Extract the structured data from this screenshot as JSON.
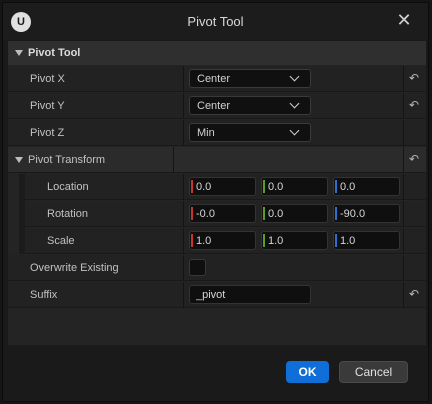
{
  "window": {
    "title": "Pivot Tool",
    "logo_text": "U"
  },
  "categories": {
    "pivot_tool": "Pivot Tool",
    "pivot_transform": "Pivot Transform"
  },
  "properties": {
    "pivot_x": {
      "label": "Pivot X",
      "value": "Center"
    },
    "pivot_y": {
      "label": "Pivot Y",
      "value": "Center"
    },
    "pivot_z": {
      "label": "Pivot Z",
      "value": "Min"
    }
  },
  "transform": {
    "location": {
      "label": "Location",
      "x": "0.0",
      "y": "0.0",
      "z": "0.0"
    },
    "rotation": {
      "label": "Rotation",
      "x": "-0.0",
      "y": "0.0",
      "z": "-90.0"
    },
    "scale": {
      "label": "Scale",
      "x": "1.0",
      "y": "1.0",
      "z": "1.0"
    }
  },
  "overwrite": {
    "label": "Overwrite Existing",
    "checked": false
  },
  "suffix": {
    "label": "Suffix",
    "value": "_pivot"
  },
  "buttons": {
    "ok": "OK",
    "cancel": "Cancel"
  },
  "icons": {
    "close": "close-icon",
    "reset": "reset-arrow-icon",
    "expand": "triangle-down-icon"
  },
  "colors": {
    "axis_x": "#c7352c",
    "axis_y": "#5a9e2a",
    "axis_z": "#2f6fd0",
    "accent": "#0f6ed7"
  }
}
